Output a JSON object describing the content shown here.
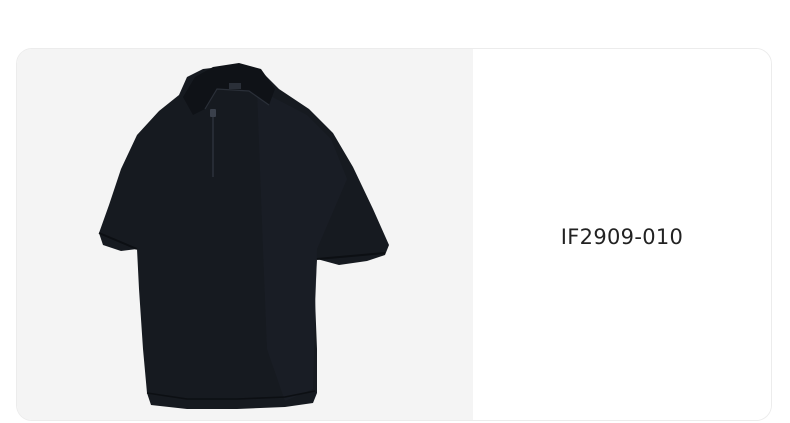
{
  "product": {
    "code": "IF2909-010",
    "image_icon": "short-sleeve-polo-shirt",
    "garment_color": "#161a20",
    "image_background": "#f4f4f4"
  }
}
